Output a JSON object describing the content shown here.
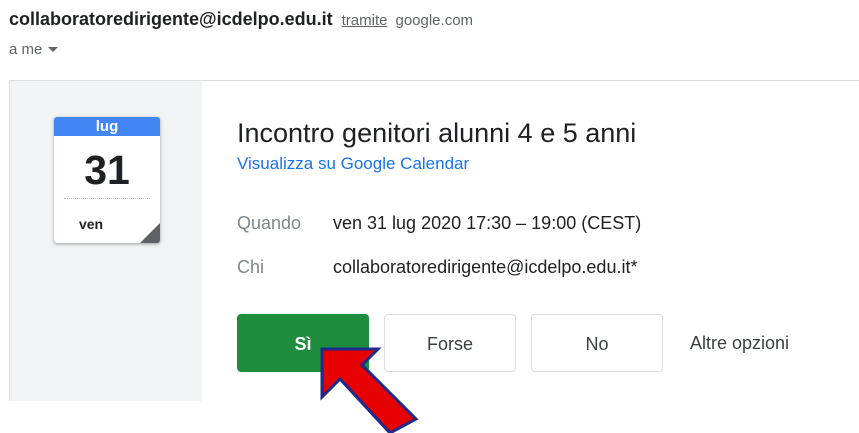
{
  "header": {
    "sender_email": "collaboratoredirigente@icdelpo.edu.it",
    "via_label": "tramite",
    "via_domain": "google.com",
    "recipient": "a me"
  },
  "calendar_icon": {
    "month": "lug",
    "day": "31",
    "weekday": "ven",
    "month_color": "#4285f4"
  },
  "event": {
    "title": "Incontro genitori alunni 4 e 5 anni",
    "view_link": "Visualizza su Google Calendar",
    "when_label": "Quando",
    "when_value": "ven 31 lug 2020 17:30 – 19:00 (CEST)",
    "who_label": "Chi",
    "who_value": "collaboratoredirigente@icdelpo.edu.it*"
  },
  "rsvp": {
    "yes_label": "Sì",
    "maybe_label": "Forse",
    "no_label": "No",
    "more_label": "Altre opzioni",
    "yes_color": "#1e8e3e"
  },
  "annotation": {
    "arrow_icon": "arrow-pointer-icon",
    "arrow_color": "#e60000"
  }
}
